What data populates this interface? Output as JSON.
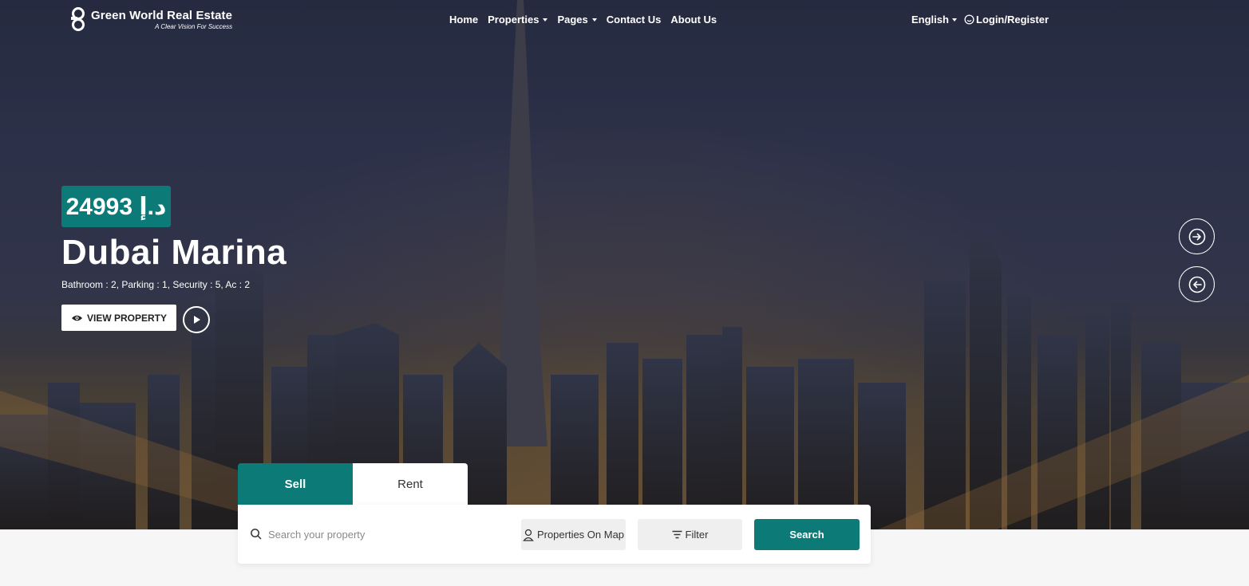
{
  "brand": {
    "name": "Green World Real Estate",
    "tagline": "A Clear Vision For Success"
  },
  "nav": {
    "items": [
      {
        "label": "Home",
        "has_dropdown": false
      },
      {
        "label": "Properties",
        "has_dropdown": true
      },
      {
        "label": "Pages",
        "has_dropdown": true
      },
      {
        "label": "Contact Us",
        "has_dropdown": false
      },
      {
        "label": "About Us",
        "has_dropdown": false
      }
    ],
    "language": "English",
    "login": "Login/Register"
  },
  "hero": {
    "price": "24993 د.إ",
    "title": "Dubai Marina",
    "features": "Bathroom : 2,  Parking : 1,  Security : 5,  Ac : 2",
    "view_button": "VIEW PROPERTY"
  },
  "search": {
    "tabs": [
      {
        "label": "Sell",
        "active": true
      },
      {
        "label": "Rent",
        "active": false
      }
    ],
    "placeholder": "Search your property",
    "map_button": "Properties On Map",
    "filter_button": "Filter",
    "submit_button": "Search"
  },
  "colors": {
    "accent": "#0c7b78",
    "text_light": "#ffffff"
  }
}
